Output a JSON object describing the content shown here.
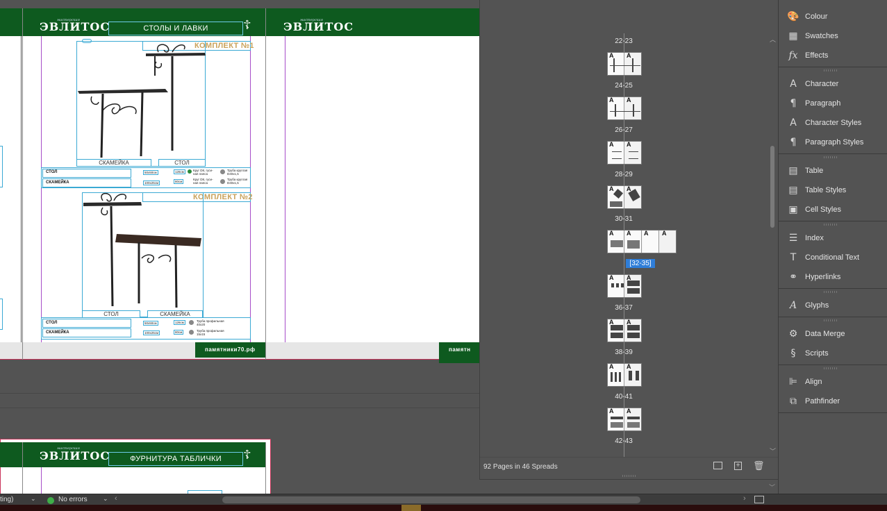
{
  "document": {
    "logo_small": "мастерская",
    "logo_name": "ЭВЛИТОС",
    "spread1_title": "СТОЛЫ И ЛАВКИ",
    "spread2_title": "ФУРНИТУРА ТАБЛИЧКИ",
    "kit1": "КОМПЛЕКТ №1",
    "kit2": "КОМПЛЕКТ №2",
    "kit1_left_caption": "СКАМЕЙКА",
    "kit1_right_caption": "СТОЛ",
    "kit2_left_caption": "СТОЛ",
    "kit2_right_caption": "СКАМЕЙКА",
    "row_table": "СТОЛ",
    "row_bench": "СКАМЕЙКА",
    "size1": "50х50см",
    "size2": "100х25см",
    "h1": "126см",
    "h2": "80см",
    "m1": "Круг D8, гуси-ная лапса",
    "m2": "Труба круглая D40х1,5",
    "m3": "Труба профильная 40х20",
    "m4": "Труба профильная 15х15",
    "footer": "памятники70.рф",
    "footer_partial": "памятн"
  },
  "status": {
    "left_label": "ting)",
    "errors": "No errors"
  },
  "pages_panel": {
    "spreads": [
      {
        "label": "22-23",
        "selected": false
      },
      {
        "label": "24-25",
        "selected": false
      },
      {
        "label": "26-27",
        "selected": false
      },
      {
        "label": "28-29",
        "selected": false
      },
      {
        "label": "30-31",
        "selected": false
      },
      {
        "label": "[32-35]",
        "selected": true
      },
      {
        "label": "36-37",
        "selected": false
      },
      {
        "label": "38-39",
        "selected": false
      },
      {
        "label": "40-41",
        "selected": false
      },
      {
        "label": "42-43",
        "selected": false
      }
    ],
    "summary": "92 Pages in 46 Spreads",
    "master_letter": "A",
    "selection_color": "#2f7ed8"
  },
  "dock": {
    "items": [
      {
        "label": "Colour",
        "icon": "colour-icon"
      },
      {
        "label": "Swatches",
        "icon": "swatches-icon"
      },
      {
        "label": "Effects",
        "icon": "effects-icon"
      },
      {
        "label": "Character",
        "icon": "character-icon"
      },
      {
        "label": "Paragraph",
        "icon": "paragraph-icon"
      },
      {
        "label": "Character Styles",
        "icon": "character-styles-icon"
      },
      {
        "label": "Paragraph Styles",
        "icon": "paragraph-styles-icon"
      },
      {
        "label": "Table",
        "icon": "table-icon"
      },
      {
        "label": "Table Styles",
        "icon": "table-styles-icon"
      },
      {
        "label": "Cell Styles",
        "icon": "cell-styles-icon"
      },
      {
        "label": "Index",
        "icon": "index-icon"
      },
      {
        "label": "Conditional Text",
        "icon": "conditional-text-icon"
      },
      {
        "label": "Hyperlinks",
        "icon": "hyperlinks-icon"
      },
      {
        "label": "Glyphs",
        "icon": "glyphs-icon"
      },
      {
        "label": "Data Merge",
        "icon": "data-merge-icon"
      },
      {
        "label": "Scripts",
        "icon": "scripts-icon"
      },
      {
        "label": "Align",
        "icon": "align-icon"
      },
      {
        "label": "Pathfinder",
        "icon": "pathfinder-icon"
      }
    ]
  },
  "colors": {
    "brand_green": "#0e5a1f",
    "gold": "#c9a25b",
    "frame_blue": "#3aa9d4",
    "guide_purple": "#a64cc8"
  }
}
